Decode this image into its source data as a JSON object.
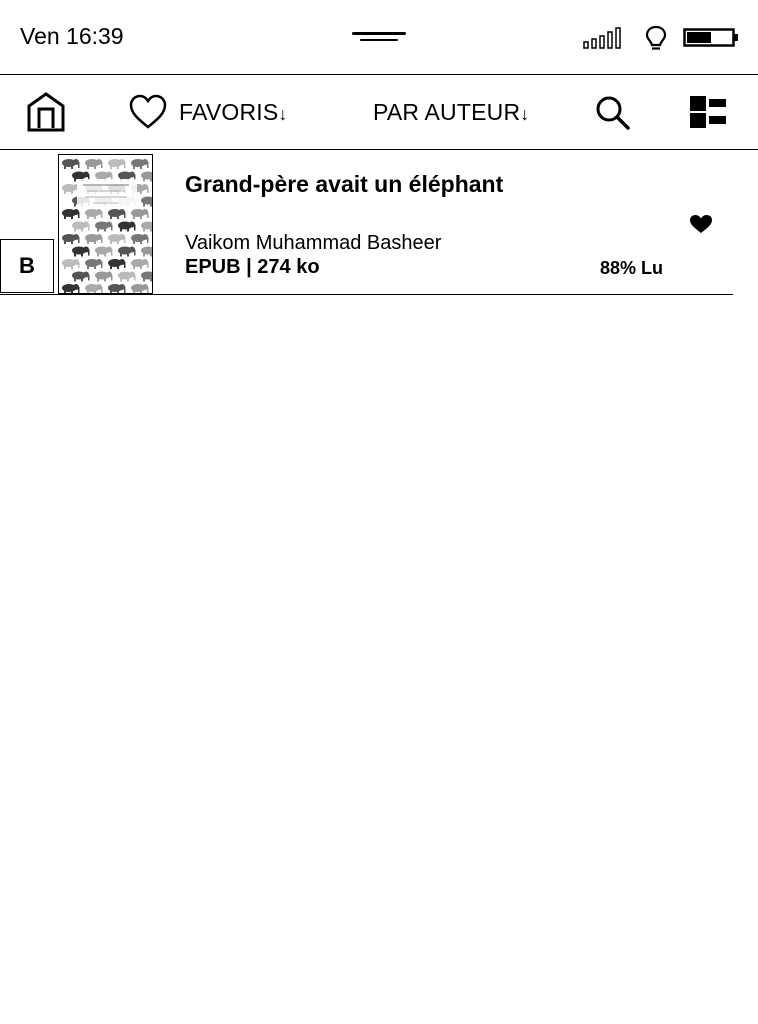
{
  "status_bar": {
    "clock": "Ven 16:39",
    "icons": [
      "signal-icon",
      "frontlight-icon",
      "battery-icon"
    ],
    "battery_level": 0.55
  },
  "toolbar": {
    "home_icon": "home-icon",
    "favorites_icon": "heart-outline-icon",
    "favorites_label": "FAVORIS",
    "sort_label": "PAR AUTEUR",
    "search_icon": "search-icon",
    "view_icon": "list-view-icon"
  },
  "books": [
    {
      "letter": "B",
      "title": "Grand-père avait un éléphant",
      "author": "Vaikom Muhammad Basheer",
      "meta": "EPUB | 274 ko",
      "progress": "88% Lu",
      "favorite": true
    }
  ]
}
